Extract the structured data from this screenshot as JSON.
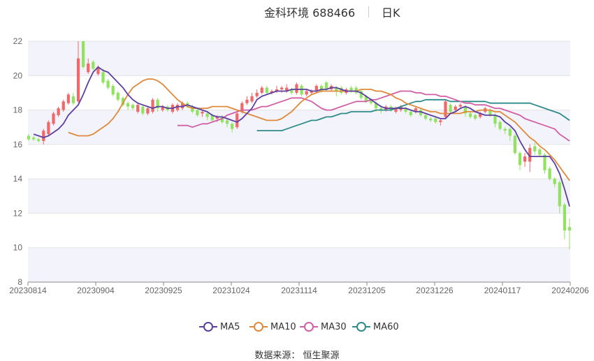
{
  "title": {
    "name": "金科环境 688466",
    "period": "日K"
  },
  "source": {
    "text": "数据来源：  恒生聚源"
  },
  "colors": {
    "up": "#f0686a",
    "down": "#8fe35e",
    "ma5": "#5b3fa1",
    "ma10": "#e0893a",
    "ma30": "#d05fa5",
    "ma60": "#2f8a8a",
    "band": "#f3f4fb",
    "grid": "#e3e3e3",
    "axis": "#666666"
  },
  "chart_data": {
    "type": "candlestick",
    "y_ticks": [
      8,
      10,
      12,
      14,
      16,
      18,
      20,
      22
    ],
    "ylim": [
      8,
      22
    ],
    "x_ticks": [
      "20230814",
      "20230904",
      "20230925",
      "20231024",
      "20231114",
      "20231205",
      "20231226",
      "20240117",
      "20240206"
    ],
    "candles": [
      {
        "o": 16.5,
        "c": 16.3,
        "h": 16.6,
        "l": 16.2
      },
      {
        "o": 16.4,
        "c": 16.3,
        "h": 16.5,
        "l": 16.2
      },
      {
        "o": 16.3,
        "c": 16.2,
        "h": 16.4,
        "l": 16.1
      },
      {
        "o": 16.2,
        "c": 16.8,
        "h": 16.9,
        "l": 16.0
      },
      {
        "o": 16.6,
        "c": 17.3,
        "h": 17.4,
        "l": 16.5
      },
      {
        "o": 17.2,
        "c": 17.8,
        "h": 17.9,
        "l": 17.1
      },
      {
        "o": 17.7,
        "c": 18.1,
        "h": 18.2,
        "l": 17.6
      },
      {
        "o": 18.0,
        "c": 18.5,
        "h": 18.6,
        "l": 17.9
      },
      {
        "o": 18.4,
        "c": 18.9,
        "h": 19.0,
        "l": 18.3
      },
      {
        "o": 18.8,
        "c": 18.4,
        "h": 19.0,
        "l": 18.3
      },
      {
        "o": 18.5,
        "c": 21.0,
        "h": 22.0,
        "l": 18.4
      },
      {
        "o": 22.0,
        "c": 20.5,
        "h": 22.0,
        "l": 20.4
      },
      {
        "o": 20.2,
        "c": 20.7,
        "h": 21.0,
        "l": 20.1
      },
      {
        "o": 20.8,
        "c": 20.4,
        "h": 20.9,
        "l": 20.3
      },
      {
        "o": 20.1,
        "c": 20.5,
        "h": 20.6,
        "l": 20.0
      },
      {
        "o": 20.2,
        "c": 19.6,
        "h": 20.4,
        "l": 19.5
      },
      {
        "o": 19.7,
        "c": 19.3,
        "h": 19.8,
        "l": 19.2
      },
      {
        "o": 19.4,
        "c": 18.9,
        "h": 19.5,
        "l": 18.8
      },
      {
        "o": 19.0,
        "c": 18.6,
        "h": 19.1,
        "l": 18.5
      },
      {
        "o": 18.7,
        "c": 18.3,
        "h": 18.8,
        "l": 18.2
      },
      {
        "o": 18.4,
        "c": 18.2,
        "h": 18.5,
        "l": 18.0
      },
      {
        "o": 18.3,
        "c": 18.1,
        "h": 18.4,
        "l": 18.0
      },
      {
        "o": 17.9,
        "c": 18.3,
        "h": 18.4,
        "l": 17.8
      },
      {
        "o": 18.2,
        "c": 17.8,
        "h": 18.3,
        "l": 17.7
      },
      {
        "o": 17.8,
        "c": 18.1,
        "h": 18.2,
        "l": 17.7
      },
      {
        "o": 17.9,
        "c": 18.6,
        "h": 18.7,
        "l": 17.8
      },
      {
        "o": 18.6,
        "c": 18.1,
        "h": 18.7,
        "l": 17.9
      },
      {
        "o": 18.0,
        "c": 18.2,
        "h": 18.3,
        "l": 17.9
      },
      {
        "o": 18.2,
        "c": 18.0,
        "h": 18.3,
        "l": 17.9
      },
      {
        "o": 17.9,
        "c": 18.3,
        "h": 18.4,
        "l": 17.8
      },
      {
        "o": 18.0,
        "c": 18.3,
        "h": 18.4,
        "l": 17.9
      },
      {
        "o": 18.1,
        "c": 18.4,
        "h": 18.5,
        "l": 18.0
      },
      {
        "o": 18.4,
        "c": 18.2,
        "h": 18.5,
        "l": 18.1
      },
      {
        "o": 18.2,
        "c": 17.9,
        "h": 18.3,
        "l": 17.8
      },
      {
        "o": 18.0,
        "c": 17.7,
        "h": 18.1,
        "l": 17.6
      },
      {
        "o": 17.8,
        "c": 17.9,
        "h": 18.0,
        "l": 17.6
      },
      {
        "o": 17.8,
        "c": 17.6,
        "h": 17.9,
        "l": 17.4
      },
      {
        "o": 17.7,
        "c": 17.4,
        "h": 17.8,
        "l": 17.3
      },
      {
        "o": 17.5,
        "c": 17.6,
        "h": 17.7,
        "l": 17.3
      },
      {
        "o": 17.6,
        "c": 17.3,
        "h": 17.7,
        "l": 17.2
      },
      {
        "o": 17.4,
        "c": 17.2,
        "h": 17.5,
        "l": 17.0
      },
      {
        "o": 17.2,
        "c": 16.9,
        "h": 17.3,
        "l": 16.7
      },
      {
        "o": 17.0,
        "c": 17.8,
        "h": 17.9,
        "l": 16.9
      },
      {
        "o": 17.9,
        "c": 18.4,
        "h": 18.5,
        "l": 17.8
      },
      {
        "o": 18.4,
        "c": 18.6,
        "h": 18.8,
        "l": 18.3
      },
      {
        "o": 18.5,
        "c": 18.8,
        "h": 19.0,
        "l": 18.4
      },
      {
        "o": 18.8,
        "c": 19.0,
        "h": 19.2,
        "l": 18.7
      },
      {
        "o": 19.0,
        "c": 19.3,
        "h": 19.4,
        "l": 18.9
      },
      {
        "o": 19.3,
        "c": 19.0,
        "h": 19.4,
        "l": 18.9
      },
      {
        "o": 19.0,
        "c": 19.1,
        "h": 19.2,
        "l": 18.9
      },
      {
        "o": 19.1,
        "c": 19.2,
        "h": 19.4,
        "l": 19.0
      },
      {
        "o": 19.2,
        "c": 19.3,
        "h": 19.4,
        "l": 19.0
      },
      {
        "o": 19.1,
        "c": 19.3,
        "h": 19.5,
        "l": 19.0
      },
      {
        "o": 19.2,
        "c": 19.0,
        "h": 19.3,
        "l": 18.9
      },
      {
        "o": 19.0,
        "c": 19.5,
        "h": 19.6,
        "l": 18.9
      },
      {
        "o": 19.4,
        "c": 18.9,
        "h": 19.5,
        "l": 18.8
      },
      {
        "o": 18.9,
        "c": 19.1,
        "h": 19.2,
        "l": 18.8
      },
      {
        "o": 19.0,
        "c": 19.1,
        "h": 19.2,
        "l": 18.9
      },
      {
        "o": 19.1,
        "c": 19.4,
        "h": 19.5,
        "l": 19.0
      },
      {
        "o": 19.4,
        "c": 19.1,
        "h": 19.5,
        "l": 19.0
      },
      {
        "o": 19.6,
        "c": 19.2,
        "h": 19.7,
        "l": 19.1
      },
      {
        "o": 19.2,
        "c": 19.4,
        "h": 19.5,
        "l": 19.1
      },
      {
        "o": 19.3,
        "c": 19.1,
        "h": 19.4,
        "l": 18.8
      },
      {
        "o": 19.3,
        "c": 19.0,
        "h": 19.4,
        "l": 18.9
      },
      {
        "o": 19.0,
        "c": 19.2,
        "h": 19.3,
        "l": 18.9
      },
      {
        "o": 19.3,
        "c": 19.1,
        "h": 19.4,
        "l": 19.0
      },
      {
        "o": 19.3,
        "c": 19.0,
        "h": 19.4,
        "l": 18.9
      },
      {
        "o": 19.1,
        "c": 18.7,
        "h": 19.2,
        "l": 18.6
      },
      {
        "o": 18.8,
        "c": 18.5,
        "h": 18.9,
        "l": 18.4
      },
      {
        "o": 18.6,
        "c": 18.4,
        "h": 18.7,
        "l": 18.3
      },
      {
        "o": 18.4,
        "c": 18.1,
        "h": 18.5,
        "l": 17.9
      },
      {
        "o": 18.1,
        "c": 18.0,
        "h": 18.3,
        "l": 17.8
      },
      {
        "o": 18.0,
        "c": 18.2,
        "h": 18.3,
        "l": 17.9
      },
      {
        "o": 18.2,
        "c": 18.0,
        "h": 18.3,
        "l": 17.9
      },
      {
        "o": 17.9,
        "c": 18.1,
        "h": 18.2,
        "l": 17.8
      },
      {
        "o": 18.0,
        "c": 18.2,
        "h": 18.3,
        "l": 17.9
      },
      {
        "o": 18.1,
        "c": 17.9,
        "h": 18.2,
        "l": 17.8
      },
      {
        "o": 17.9,
        "c": 17.7,
        "h": 18.0,
        "l": 17.6
      },
      {
        "o": 17.9,
        "c": 18.1,
        "h": 18.2,
        "l": 17.8
      },
      {
        "o": 18.0,
        "c": 17.7,
        "h": 18.1,
        "l": 17.6
      },
      {
        "o": 17.7,
        "c": 17.5,
        "h": 17.8,
        "l": 17.4
      },
      {
        "o": 17.5,
        "c": 17.4,
        "h": 17.6,
        "l": 17.3
      },
      {
        "o": 17.5,
        "c": 17.3,
        "h": 17.6,
        "l": 17.2
      },
      {
        "o": 17.3,
        "c": 17.4,
        "h": 17.5,
        "l": 17.1
      },
      {
        "o": 17.6,
        "c": 18.5,
        "h": 18.6,
        "l": 17.5
      },
      {
        "o": 18.3,
        "c": 17.9,
        "h": 18.4,
        "l": 17.8
      },
      {
        "o": 18.0,
        "c": 18.2,
        "h": 18.3,
        "l": 17.9
      },
      {
        "o": 18.2,
        "c": 18.3,
        "h": 18.4,
        "l": 18.1
      },
      {
        "o": 18.2,
        "c": 17.8,
        "h": 18.3,
        "l": 17.6
      },
      {
        "o": 17.8,
        "c": 17.6,
        "h": 17.9,
        "l": 17.5
      },
      {
        "o": 17.7,
        "c": 17.5,
        "h": 17.8,
        "l": 17.4
      },
      {
        "o": 17.6,
        "c": 17.8,
        "h": 17.9,
        "l": 17.5
      },
      {
        "o": 17.9,
        "c": 18.1,
        "h": 18.2,
        "l": 17.8
      },
      {
        "o": 18.0,
        "c": 17.7,
        "h": 18.1,
        "l": 17.6
      },
      {
        "o": 17.7,
        "c": 17.2,
        "h": 17.8,
        "l": 17.0
      },
      {
        "o": 17.3,
        "c": 16.9,
        "h": 17.4,
        "l": 16.8
      },
      {
        "o": 16.9,
        "c": 16.8,
        "h": 17.0,
        "l": 16.6
      },
      {
        "o": 16.9,
        "c": 16.5,
        "h": 17.0,
        "l": 16.2
      },
      {
        "o": 16.5,
        "c": 15.5,
        "h": 16.6,
        "l": 15.4
      },
      {
        "o": 15.5,
        "c": 14.8,
        "h": 15.6,
        "l": 14.5
      },
      {
        "o": 15.0,
        "c": 15.3,
        "h": 15.5,
        "l": 14.7
      },
      {
        "o": 15.0,
        "c": 15.8,
        "h": 16.0,
        "l": 14.4
      },
      {
        "o": 15.9,
        "c": 15.6,
        "h": 16.1,
        "l": 15.4
      },
      {
        "o": 15.7,
        "c": 15.4,
        "h": 15.8,
        "l": 15.3
      },
      {
        "o": 15.4,
        "c": 14.5,
        "h": 15.5,
        "l": 14.3
      },
      {
        "o": 14.6,
        "c": 14.0,
        "h": 14.7,
        "l": 13.9
      },
      {
        "o": 14.0,
        "c": 13.7,
        "h": 14.1,
        "l": 13.5
      },
      {
        "o": 13.8,
        "c": 12.4,
        "h": 13.9,
        "l": 12.0
      },
      {
        "o": 12.5,
        "c": 11.0,
        "h": 12.6,
        "l": 10.5
      },
      {
        "o": 11.2,
        "c": 11.0,
        "h": 11.7,
        "l": 9.9
      }
    ],
    "ma5": [
      16.6,
      16.5,
      16.4,
      16.5,
      16.7,
      16.9,
      17.2,
      17.7,
      18.0,
      18.3,
      18.9,
      19.6,
      20.2,
      20.5,
      20.3,
      20.2,
      19.9,
      19.6,
      19.3,
      18.9,
      18.6,
      18.4,
      18.3,
      18.2,
      18.1,
      18.2,
      18.2,
      18.1,
      18.1,
      18.2,
      18.2,
      18.3,
      18.2,
      18.1,
      18.0,
      17.9,
      17.7,
      17.6,
      17.6,
      17.5,
      17.4,
      17.3,
      17.5,
      17.8,
      18.1,
      18.6,
      18.8,
      18.9,
      19.0,
      19.1,
      19.1,
      19.1,
      19.2,
      19.2,
      19.2,
      19.2,
      19.1,
      19.1,
      19.2,
      19.2,
      19.3,
      19.3,
      19.2,
      19.1,
      19.1,
      19.1,
      19.0,
      18.8,
      18.6,
      18.4,
      18.2,
      18.1,
      18.1,
      18.1,
      18.1,
      18.1,
      18.0,
      17.9,
      17.9,
      17.8,
      17.7,
      17.6,
      17.5,
      17.5,
      17.8,
      17.9,
      18.1,
      18.2,
      18.1,
      17.9,
      17.8,
      17.7,
      17.7,
      17.7,
      17.6,
      17.3,
      17.1,
      16.8,
      16.2,
      15.7,
      15.3,
      15.3,
      15.3,
      15.3,
      15.3,
      14.9,
      14.3,
      13.4,
      12.4
    ],
    "ma10": [
      16.7,
      16.6,
      16.5,
      16.5,
      16.5,
      16.6,
      16.8,
      17.0,
      17.2,
      17.5,
      17.9,
      18.4,
      18.9,
      19.3,
      19.5,
      19.7,
      19.8,
      19.8,
      19.7,
      19.5,
      19.2,
      18.9,
      18.6,
      18.4,
      18.2,
      18.1,
      18.1,
      18.1,
      18.1,
      18.2,
      18.2,
      18.2,
      18.2,
      18.1,
      18.0,
      17.9,
      17.8,
      17.7,
      17.6,
      17.5,
      17.4,
      17.4,
      17.4,
      17.5,
      17.7,
      17.9,
      18.2,
      18.5,
      18.7,
      18.9,
      19.0,
      19.1,
      19.1,
      19.1,
      19.1,
      19.1,
      19.1,
      19.1,
      19.1,
      19.2,
      19.2,
      19.2,
      19.1,
      19.1,
      19.0,
      18.9,
      18.7,
      18.6,
      18.4,
      18.3,
      18.2,
      18.1,
      18.0,
      17.9,
      17.9,
      17.8,
      17.8,
      17.8,
      17.8,
      17.8,
      17.9,
      17.9,
      17.9,
      18.0,
      18.0,
      18.0,
      17.9,
      17.9,
      17.7,
      17.5,
      17.3,
      17.0,
      16.7,
      16.4,
      16.2,
      15.9,
      15.7,
      15.4,
      15.1,
      14.7,
      14.3,
      13.9
    ],
    "ma30": [
      17.1,
      17.1,
      17.1,
      17.0,
      17.1,
      17.2,
      17.2,
      17.3,
      17.4,
      17.5,
      17.7,
      17.8,
      17.9,
      18.0,
      18.0,
      18.0,
      18.1,
      18.2,
      18.2,
      18.3,
      18.4,
      18.5,
      18.6,
      18.7,
      18.7,
      18.7,
      18.6,
      18.5,
      18.3,
      18.1,
      18.0,
      18.0,
      18.1,
      18.2,
      18.3,
      18.4,
      18.5,
      18.5,
      18.5,
      18.6,
      18.6,
      18.7,
      18.8,
      18.9,
      19.0,
      19.1,
      19.1,
      19.1,
      19.0,
      19.0,
      18.9,
      18.9,
      18.9,
      18.8,
      18.8,
      18.7,
      18.6,
      18.5,
      18.4,
      18.4,
      18.3,
      18.3,
      18.3,
      18.2,
      18.1,
      18.1,
      18.0,
      17.9,
      17.8,
      17.7,
      17.5,
      17.4,
      17.3,
      17.2,
      17.1,
      17.0,
      16.9,
      16.6,
      16.4,
      16.2
    ],
    "ma60": [
      16.8,
      16.8,
      16.8,
      16.8,
      16.8,
      16.8,
      16.9,
      17.0,
      17.1,
      17.2,
      17.3,
      17.4,
      17.4,
      17.5,
      17.6,
      17.6,
      17.7,
      17.8,
      17.8,
      17.9,
      17.9,
      17.9,
      17.9,
      17.9,
      18.0,
      18.0,
      18.0,
      18.0,
      18.1,
      18.2,
      18.3,
      18.4,
      18.5,
      18.5,
      18.6,
      18.6,
      18.6,
      18.6,
      18.6,
      18.5,
      18.5,
      18.5,
      18.5,
      18.5,
      18.5,
      18.5,
      18.5,
      18.4,
      18.4,
      18.4,
      18.4,
      18.4,
      18.4,
      18.4,
      18.4,
      18.4,
      18.3,
      18.2,
      18.1,
      18.0,
      17.9,
      17.8,
      17.6,
      17.4
    ],
    "legend": [
      {
        "name": "MA5"
      },
      {
        "name": "MA10"
      },
      {
        "name": "MA30"
      },
      {
        "name": "MA60"
      }
    ]
  }
}
